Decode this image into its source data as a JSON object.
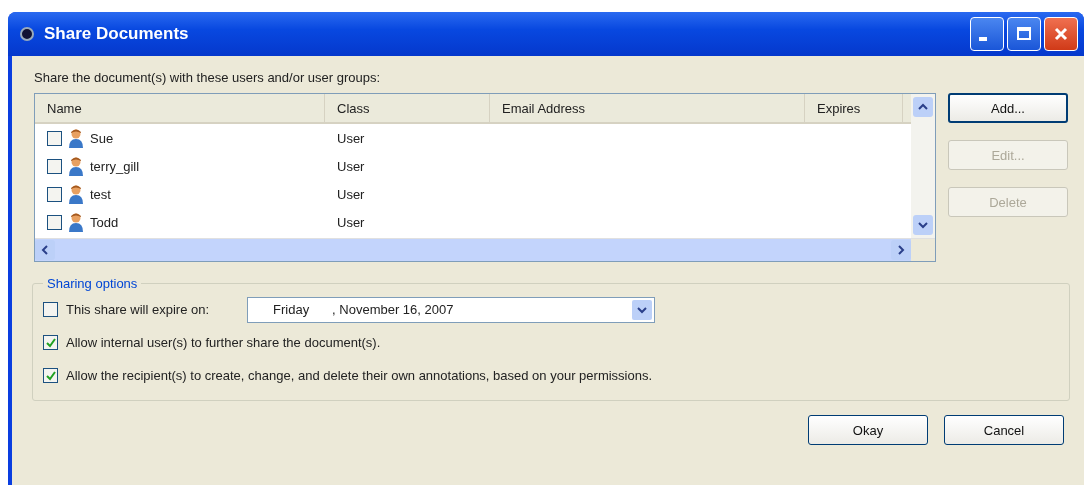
{
  "window": {
    "title": "Share Documents"
  },
  "instruction": "Share the document(s) with these users and/or user groups:",
  "table": {
    "columns": [
      "Name",
      "Class",
      "Email Address",
      "Expires"
    ],
    "rows": [
      {
        "checked": false,
        "name": "Sue",
        "class": "User"
      },
      {
        "checked": false,
        "name": "terry_gill",
        "class": "User"
      },
      {
        "checked": false,
        "name": "test",
        "class": "User"
      },
      {
        "checked": false,
        "name": "Todd",
        "class": "User"
      }
    ]
  },
  "side_buttons": [
    {
      "label": "Add...",
      "disabled": false
    },
    {
      "label": "Edit...",
      "disabled": true
    },
    {
      "label": "Delete",
      "disabled": true
    }
  ],
  "sharing_options": {
    "title": "Sharing options",
    "options": [
      {
        "kind": "date",
        "checked": false,
        "label": "This share will expire on:",
        "day": "Friday",
        "date": ", November 16, 2007"
      },
      {
        "kind": "checkbox",
        "checked": true,
        "label": "Allow internal user(s) to further share the document(s)."
      },
      {
        "kind": "checkbox",
        "checked": true,
        "label": "Allow the recipient(s) to create, change, and delete their own annotations, based on your permissions."
      }
    ]
  },
  "footer_buttons": [
    "Okay",
    "Cancel"
  ]
}
